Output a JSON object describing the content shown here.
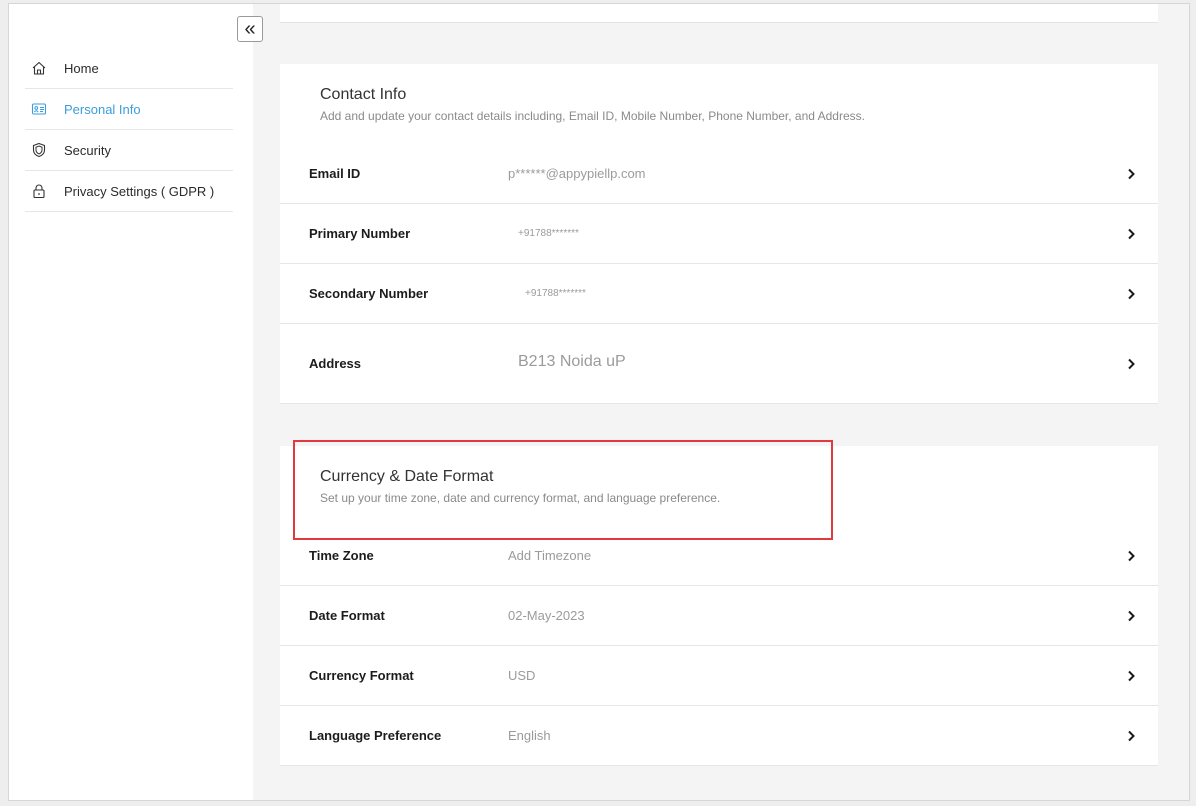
{
  "sidebar": {
    "collapse_icon": "double-chevron-left-icon",
    "collapse_glyph": "«",
    "items": [
      {
        "label": "Home",
        "icon": "home-icon"
      },
      {
        "label": "Personal Info",
        "icon": "id-card-icon",
        "active": true
      },
      {
        "label": "Security",
        "icon": "shield-icon"
      },
      {
        "label": "Privacy Settings ( GDPR )",
        "icon": "lock-icon"
      }
    ]
  },
  "contact": {
    "title": "Contact Info",
    "subtitle": "Add and update your contact details including, Email ID, Mobile Number, Phone Number, and Address.",
    "rows": [
      {
        "label": "Email ID",
        "value": "p******@appypiellp.com"
      },
      {
        "label": "Primary Number",
        "value": "+91788*******"
      },
      {
        "label": "Secondary Number",
        "value": "+91788*******"
      },
      {
        "label": "Address",
        "value": "B213  Noida uP"
      }
    ]
  },
  "currency": {
    "title": "Currency & Date Format",
    "subtitle": "Set up your time zone, date and currency format, and language preference.",
    "rows": [
      {
        "label": "Time Zone",
        "value": "Add Timezone"
      },
      {
        "label": "Date Format",
        "value": "02-May-2023"
      },
      {
        "label": "Currency Format",
        "value": "USD"
      },
      {
        "label": "Language Preference",
        "value": "English"
      }
    ]
  },
  "colors": {
    "accent": "#3b9ddd",
    "highlight": "#e0393e"
  }
}
